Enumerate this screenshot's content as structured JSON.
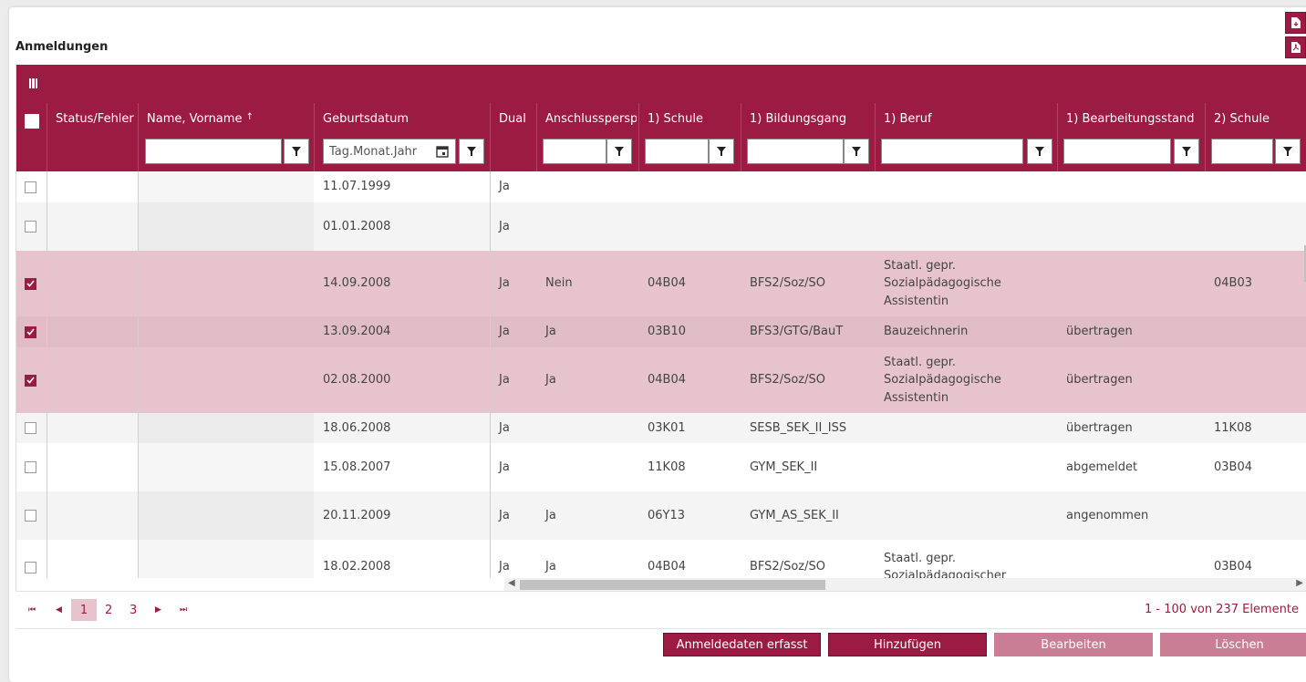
{
  "header": {
    "title": "Anmeldungen"
  },
  "export_buttons": [
    {
      "icon": "file-download-icon"
    },
    {
      "icon": "pdf-icon"
    }
  ],
  "columns": [
    {
      "key": "status",
      "label": "Status/Fehler"
    },
    {
      "key": "name",
      "label": "Name, Vorname",
      "sort": "↑"
    },
    {
      "key": "geburtsdatum",
      "label": "Geburtsdatum"
    },
    {
      "key": "dual",
      "label": "Dual"
    },
    {
      "key": "anschluss",
      "label": "Anschlussperspektive"
    },
    {
      "key": "schule1",
      "label": "1) Schule"
    },
    {
      "key": "bildungsgang1",
      "label": "1) Bildungsgang"
    },
    {
      "key": "beruf1",
      "label": "1) Beruf"
    },
    {
      "key": "bearbeitungsstand1",
      "label": "1) Bearbeitungsstand"
    },
    {
      "key": "schule2",
      "label": "2) Schule"
    }
  ],
  "filters": {
    "geburtsdatum_placeholder": "Tag.Monat.Jahr"
  },
  "rows": [
    {
      "selected": false,
      "geburtsdatum": "11.07.1999",
      "dual": "Ja",
      "anschluss": "",
      "schule1": "",
      "bildungsgang1": "",
      "beruf1": "",
      "bearbeitungsstand1": "",
      "schule2": ""
    },
    {
      "selected": false,
      "geburtsdatum": "01.01.2008",
      "dual": "Ja",
      "anschluss": "",
      "schule1": "",
      "bildungsgang1": "",
      "beruf1": "",
      "bearbeitungsstand1": "",
      "schule2": ""
    },
    {
      "selected": true,
      "geburtsdatum": "14.09.2008",
      "dual": "Ja",
      "anschluss": "Nein",
      "schule1": "04B04",
      "bildungsgang1": "BFS2/Soz/SO",
      "beruf1": "Staatl. gepr. Sozialpädagogische Assistentin",
      "bearbeitungsstand1": "",
      "schule2": "04B03"
    },
    {
      "selected": true,
      "geburtsdatum": "13.09.2004",
      "dual": "Ja",
      "anschluss": "Ja",
      "schule1": "03B10",
      "bildungsgang1": "BFS3/GTG/BauT",
      "beruf1": "Bauzeichnerin",
      "bearbeitungsstand1": "übertragen",
      "schule2": ""
    },
    {
      "selected": true,
      "geburtsdatum": "02.08.2000",
      "dual": "Ja",
      "anschluss": "Ja",
      "schule1": "04B04",
      "bildungsgang1": "BFS2/Soz/SO",
      "beruf1": "Staatl. gepr. Sozialpädagogische Assistentin",
      "bearbeitungsstand1": "übertragen",
      "schule2": ""
    },
    {
      "selected": false,
      "geburtsdatum": "18.06.2008",
      "dual": "Ja",
      "anschluss": "",
      "schule1": "03K01",
      "bildungsgang1": "SESB_SEK_II_ISS",
      "beruf1": "",
      "bearbeitungsstand1": "übertragen",
      "schule2": "11K08"
    },
    {
      "selected": false,
      "geburtsdatum": "15.08.2007",
      "dual": "Ja",
      "anschluss": "",
      "schule1": "11K08",
      "bildungsgang1": "GYM_SEK_II",
      "beruf1": "",
      "bearbeitungsstand1": "abgemeldet",
      "schule2": "03B04"
    },
    {
      "selected": false,
      "geburtsdatum": "20.11.2009",
      "dual": "Ja",
      "anschluss": "Ja",
      "schule1": "06Y13",
      "bildungsgang1": "GYM_AS_SEK_II",
      "beruf1": "",
      "bearbeitungsstand1": "angenommen",
      "schule2": ""
    },
    {
      "selected": false,
      "geburtsdatum": "18.02.2008",
      "dual": "Ja",
      "anschluss": "Ja",
      "schule1": "04B04",
      "bildungsgang1": "BFS2/Soz/SO",
      "beruf1": "Staatl. gepr. Sozialpädagogischer",
      "bearbeitungsstand1": "",
      "schule2": "03B04"
    }
  ],
  "pager": {
    "pages": [
      "1",
      "2",
      "3"
    ],
    "current": "1",
    "info": "1 - 100 von 237 Elemente"
  },
  "actions": {
    "erfasst": "Anmeldedaten erfasst",
    "hinzufuegen": "Hinzufügen",
    "bearbeiten": "Bearbeiten",
    "loeschen": "Löschen"
  },
  "colors": {
    "primary": "#9b1b42",
    "selected_row": "#e7c4cd",
    "disabled_button": "#c97e95"
  }
}
